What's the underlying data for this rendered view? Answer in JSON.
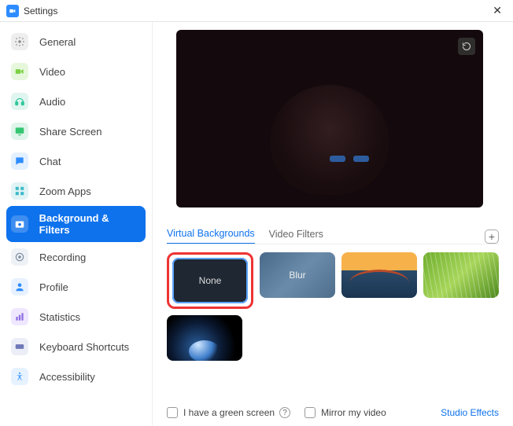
{
  "window": {
    "title": "Settings"
  },
  "sidebar": {
    "items": [
      {
        "label": "General",
        "icon_bg": "#eeeeee",
        "icon_fg": "#888"
      },
      {
        "label": "Video",
        "icon_bg": "#e6f7dc",
        "icon_fg": "#7bd142"
      },
      {
        "label": "Audio",
        "icon_bg": "#e0f5ef",
        "icon_fg": "#2fc79a"
      },
      {
        "label": "Share Screen",
        "icon_bg": "#dff4ea",
        "icon_fg": "#34c571"
      },
      {
        "label": "Chat",
        "icon_bg": "#e3f0ff",
        "icon_fg": "#2D8CFF"
      },
      {
        "label": "Zoom Apps",
        "icon_bg": "#e0f3f5",
        "icon_fg": "#3bbcc8"
      },
      {
        "label": "Background & Filters",
        "icon_bg": "#ffffff33",
        "icon_fg": "#fff",
        "active": true
      },
      {
        "label": "Recording",
        "icon_bg": "#eef2f6",
        "icon_fg": "#7a8aa0"
      },
      {
        "label": "Profile",
        "icon_bg": "#e8f1ff",
        "icon_fg": "#2D8CFF"
      },
      {
        "label": "Statistics",
        "icon_bg": "#efe7ff",
        "icon_fg": "#8f6fe3"
      },
      {
        "label": "Keyboard Shortcuts",
        "icon_bg": "#eceef7",
        "icon_fg": "#6f78b8"
      },
      {
        "label": "Accessibility",
        "icon_bg": "#e6f2ff",
        "icon_fg": "#4ea3ff"
      }
    ]
  },
  "tabs": {
    "virtual": "Virtual Backgrounds",
    "filters": "Video Filters"
  },
  "thumbs": {
    "none": "None",
    "blur": "Blur"
  },
  "footer": {
    "green_screen": "I have a green screen",
    "mirror": "Mirror my video",
    "studio": "Studio Effects"
  }
}
